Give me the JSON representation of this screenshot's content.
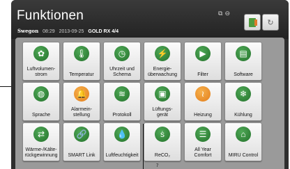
{
  "header": {
    "title": "Funktionen",
    "brand": "Swegon",
    "time": "08:29",
    "date": "2013-09-25",
    "model": "GOLD RX",
    "unit": "4/4",
    "status_glyph_1": "⧉",
    "status_glyph_2": "⊖",
    "button_gray_glyph": "↻"
  },
  "tiles": [
    {
      "label": "Luftvolumen-\nstrom",
      "icon": "fan-icon",
      "glyph": "✿",
      "color": "green"
    },
    {
      "label": "Temperatur",
      "icon": "thermometer-icon",
      "glyph": "🌡",
      "color": "green"
    },
    {
      "label": "Uhrzeit und\nSchema",
      "icon": "clock-icon",
      "glyph": "◷",
      "color": "green"
    },
    {
      "label": "Energie-\nüberwachung",
      "icon": "energy-icon",
      "glyph": "⚡",
      "color": "green"
    },
    {
      "label": "Filter",
      "icon": "filter-icon",
      "glyph": "▶",
      "color": "green"
    },
    {
      "label": "Software",
      "icon": "software-icon",
      "glyph": "▤",
      "color": "green"
    },
    {
      "label": "Sprache",
      "icon": "globe-icon",
      "glyph": "◍",
      "color": "green"
    },
    {
      "label": "Alarmein-\nstellung",
      "icon": "bell-icon",
      "glyph": "🔔",
      "color": "orange"
    },
    {
      "label": "Protokoll",
      "icon": "log-icon",
      "glyph": "≋",
      "color": "green"
    },
    {
      "label": "Lüftungs-\ngerät",
      "icon": "unit-icon",
      "glyph": "▣",
      "color": "green"
    },
    {
      "label": "Heizung",
      "icon": "heating-icon",
      "glyph": "≀",
      "color": "orange"
    },
    {
      "label": "Kühlung",
      "icon": "snowflake-icon",
      "glyph": "❄",
      "color": "green"
    },
    {
      "label": "Wärme-/Kälte-\nrückgewinnung",
      "icon": "exchanger-icon",
      "glyph": "⇄",
      "color": "green"
    },
    {
      "label": "SMART Link",
      "icon": "link-icon",
      "glyph": "🔗",
      "color": "green"
    },
    {
      "label": "Luftfeuchtigkeit",
      "icon": "drops-icon",
      "glyph": "💧",
      "color": "green"
    },
    {
      "label": "ReCO₂",
      "icon": "co2-icon",
      "glyph": "ṡ",
      "color": "green"
    },
    {
      "label": "All Year\nComfort",
      "icon": "comfort-icon",
      "glyph": "☰",
      "color": "green"
    },
    {
      "label": "MIRU Control",
      "icon": "house-icon",
      "glyph": "⌂",
      "color": "green"
    }
  ],
  "marker": "7"
}
